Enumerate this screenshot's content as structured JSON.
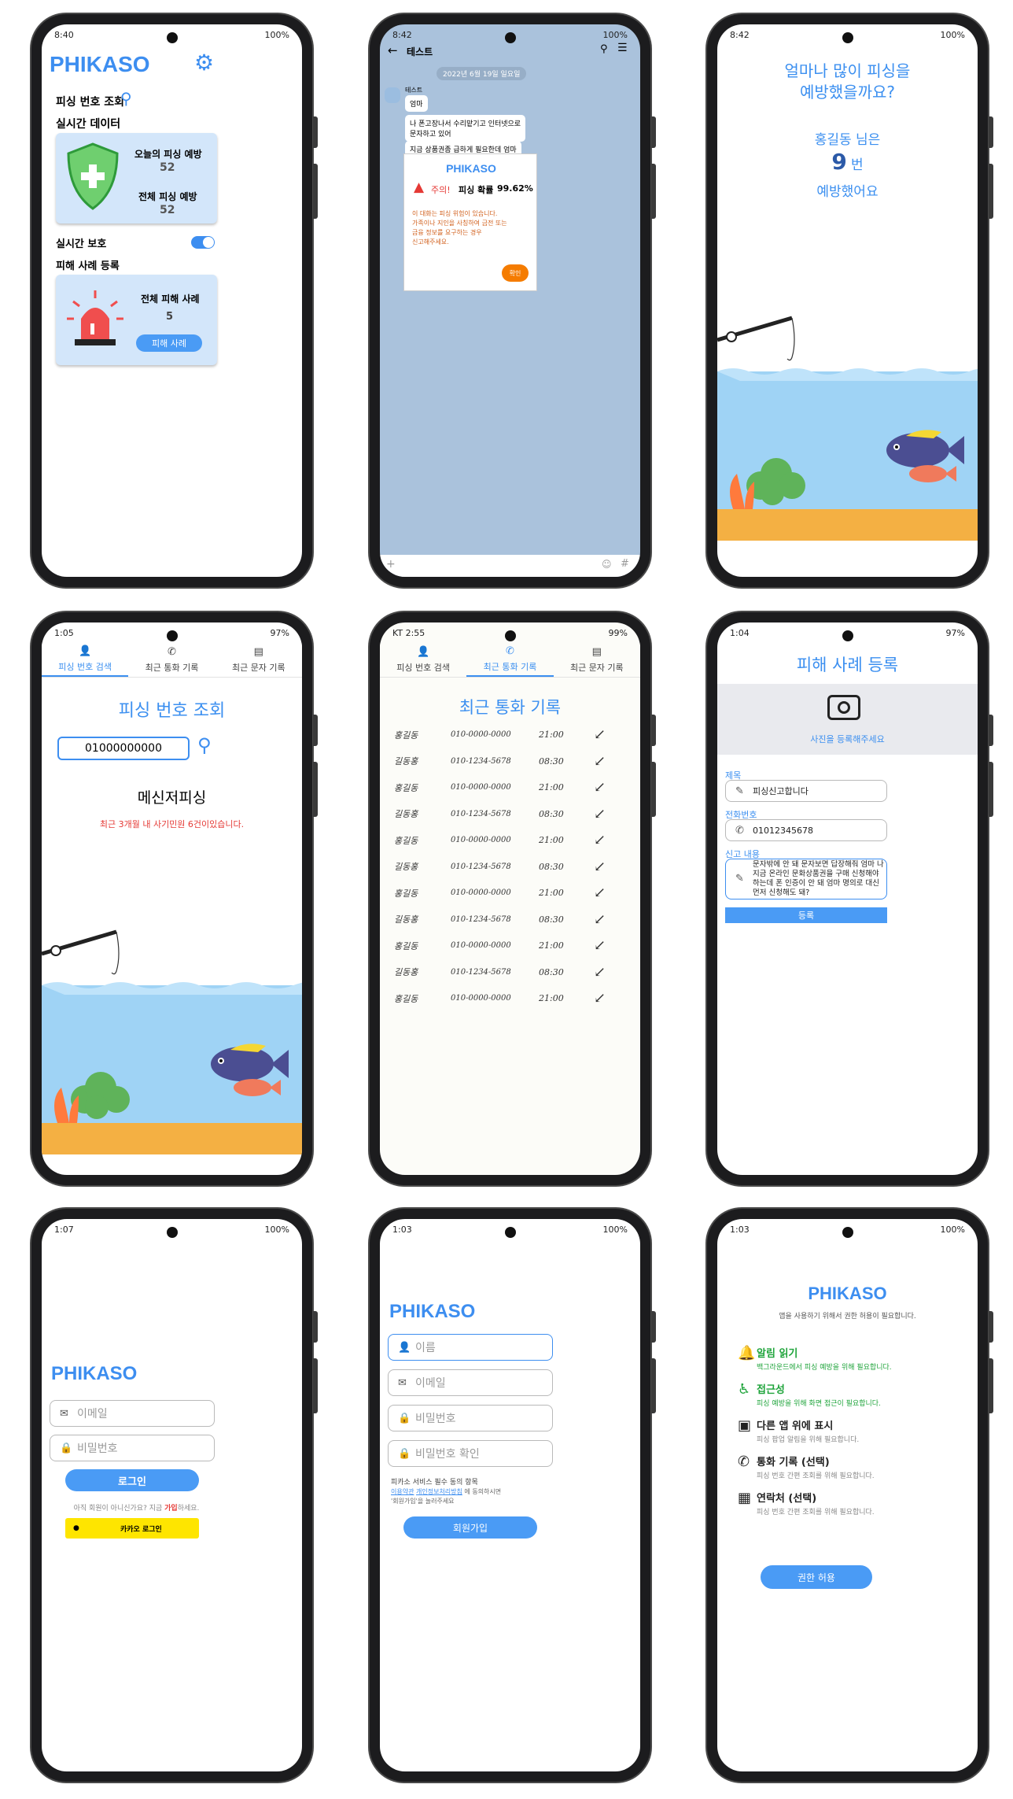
{
  "colors": {
    "brand": "#3d8ef0",
    "green": "#1fa43b",
    "danger": "#e53935",
    "kakao": "#fee500"
  },
  "s1": {
    "time": "8:40",
    "battery": "100%",
    "logo": "PHIKASO",
    "lookup": "피싱 번호 조회",
    "realtime_data": "실시간 데이터",
    "today_label": "오늘의 피싱 예방",
    "today_value": "52",
    "total_label": "전체 피싱 예방",
    "total_value": "52",
    "realtime_protect": "실시간 보호",
    "report_section": "피해 사례 등록",
    "cases_label": "전체 피해 사례",
    "cases_value": "5",
    "cases_button": "피해 사례"
  },
  "s2": {
    "time": "8:42",
    "battery": "100%",
    "title": "테스트",
    "date": "2022년 6월 19일 일요일",
    "sender": "테스트",
    "msgs": [
      "엄마",
      "나 폰고장나서 수리맡기고 인터넷으로\n문자하고 있어",
      "지금 상품권좀 급하게 필요한데 엄마"
    ],
    "popup_logo": "PHIKASO",
    "warn": "주의!",
    "prob_label": "피싱 확률",
    "prob_value": "99.62%",
    "popup_body": "이 대화는 피싱 위험이 있습니다.\n가족이나 지인을 사칭하여 금전 또는\n금융 정보를 요구하는 경우\n신고해주세요.",
    "confirm": "확인"
  },
  "s3": {
    "time": "8:42",
    "battery": "100%",
    "headline": "얼마나 많이 피싱을\n예방했을까요?",
    "name_line": "홍길동 님은",
    "count": "9",
    "unit": "번",
    "tail": "예방했어요"
  },
  "tabs": [
    "피싱 번호 검색",
    "최근 통화 기록",
    "최근 문자 기록"
  ],
  "s4": {
    "time": "1:05",
    "battery": "97%",
    "title": "피싱 번호 조회",
    "input": "01000000000",
    "result": "메신저피싱",
    "warning": "최근 3개월 내 사기민원 6건이있습니다."
  },
  "s5": {
    "time": "KT 2:55",
    "battery": "99%",
    "title": "최근 통화 기록",
    "calls": [
      {
        "name": "홍길동",
        "phone": "010-0000-0000",
        "time": "21:00"
      },
      {
        "name": "길동홍",
        "phone": "010-1234-5678",
        "time": "08:30"
      },
      {
        "name": "홍길동",
        "phone": "010-0000-0000",
        "time": "21:00"
      },
      {
        "name": "길동홍",
        "phone": "010-1234-5678",
        "time": "08:30"
      },
      {
        "name": "홍길동",
        "phone": "010-0000-0000",
        "time": "21:00"
      },
      {
        "name": "길동홍",
        "phone": "010-1234-5678",
        "time": "08:30"
      },
      {
        "name": "홍길동",
        "phone": "010-0000-0000",
        "time": "21:00"
      },
      {
        "name": "길동홍",
        "phone": "010-1234-5678",
        "time": "08:30"
      },
      {
        "name": "홍길동",
        "phone": "010-0000-0000",
        "time": "21:00"
      },
      {
        "name": "길동홍",
        "phone": "010-1234-5678",
        "time": "08:30"
      },
      {
        "name": "홍길동",
        "phone": "010-0000-0000",
        "time": "21:00"
      }
    ]
  },
  "s6": {
    "time": "1:04",
    "battery": "97%",
    "title": "피해 사례 등록",
    "photo": "사진을 등록해주세요",
    "title_label": "제목",
    "title_value": "피싱신고합니다",
    "phone_label": "전화번호",
    "phone_value": "01012345678",
    "content_label": "신고 내용",
    "content_value": "문자밖에 안 돼 문자보면 답장해줘 엄마 나 지금 온라인 문화상품권을 구매 신청해야 하는데 폰 인증이 안 돼 엄마 명의로 대신 먼저 신청해도 돼?",
    "submit": "등록"
  },
  "s7": {
    "time": "1:07",
    "battery": "100%",
    "logo": "PHIKASO",
    "email": "이메일",
    "password": "비밀번호",
    "login": "로그인",
    "signup_prefix": "아직 회원이 아니신가요? 지금 ",
    "signup_link": "가입",
    "signup_suffix": "하세요.",
    "kakao": "카카오 로그인"
  },
  "s8": {
    "time": "1:03",
    "battery": "100%",
    "logo": "PHIKASO",
    "name": "이름",
    "email": "이메일",
    "password": "비밀번호",
    "password_confirm": "비밀번호 확인",
    "terms_title": "피카소 서비스 필수 동의 항목",
    "terms_link1": "이용약관",
    "terms_link2": "개인정보처리방침",
    "terms_tail": " 에 동의하시면",
    "terms_line2": "'회원가입'을 눌러주세요",
    "submit": "회원가입"
  },
  "s9": {
    "time": "1:03",
    "battery": "100%",
    "logo": "PHIKASO",
    "subtitle": "앱을 사용하기 위해서 권한 허용이 필요합니다.",
    "perms": [
      {
        "title": "알림 읽기",
        "desc": "백그라운드에서 피싱 예방을 위해 필요합니다.",
        "icon": "bell-icon"
      },
      {
        "title": "접근성",
        "desc": "피싱 예방을 위해 화면 접근이 필요합니다.",
        "icon": "accessibility-icon"
      },
      {
        "title": "다른 앱 위에 표시",
        "desc": "피싱 팝업 알림을 위해 필요합니다.",
        "icon": "overlay-icon"
      },
      {
        "title": "통화 기록 (선택)",
        "desc": "피싱 번호 간편 조회를 위해 필요합니다.",
        "icon": "phone-icon"
      },
      {
        "title": "연락처 (선택)",
        "desc": "피싱 번호 간편 조회를 위해 필요합니다.",
        "icon": "contact-icon"
      }
    ],
    "allow": "권한 허용"
  }
}
